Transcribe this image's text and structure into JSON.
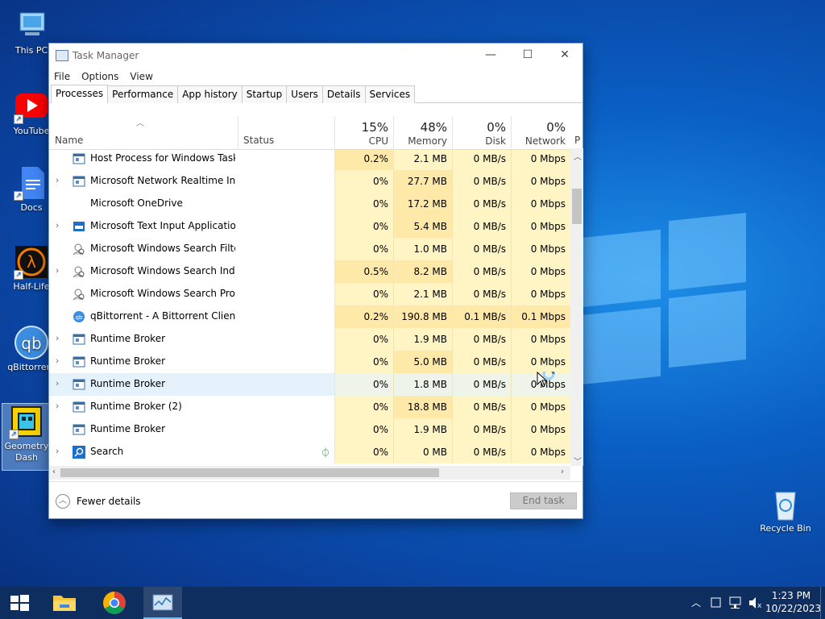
{
  "desktop": {
    "icons": [
      {
        "label": "This PC"
      },
      {
        "label": "YouTube"
      },
      {
        "label": "Docs"
      },
      {
        "label": "Half-Life"
      },
      {
        "label": "qBittorrent"
      },
      {
        "label": "Geometry Dash"
      },
      {
        "label": "Recycle Bin"
      }
    ]
  },
  "window": {
    "title": "Task Manager",
    "controls": {
      "minimize": "—",
      "maximize": "☐",
      "close": "✕"
    },
    "menu": [
      "File",
      "Options",
      "View"
    ],
    "tabs": [
      "Processes",
      "Performance",
      "App history",
      "Startup",
      "Users",
      "Details",
      "Services"
    ],
    "active_tab": "Processes"
  },
  "columns": {
    "name": "Name",
    "status": "Status",
    "cpu": {
      "pct": "15%",
      "label": "CPU"
    },
    "memory": {
      "pct": "48%",
      "label": "Memory"
    },
    "disk": {
      "pct": "0%",
      "label": "Disk"
    },
    "network": {
      "pct": "0%",
      "label": "Network"
    },
    "extra": "P"
  },
  "processes": [
    {
      "name": "Host Process for Windows Tasks",
      "expand": false,
      "cpu": "0.2%",
      "mem": "2.1 MB",
      "disk": "0 MB/s",
      "net": "0 Mbps",
      "icon": "service-icon"
    },
    {
      "name": "Microsoft Network Realtime Ins...",
      "expand": true,
      "cpu": "0%",
      "mem": "27.7 MB",
      "disk": "0 MB/s",
      "net": "0 Mbps",
      "icon": "service-icon"
    },
    {
      "name": "Microsoft OneDrive",
      "expand": false,
      "cpu": "0%",
      "mem": "17.2 MB",
      "disk": "0 MB/s",
      "net": "0 Mbps",
      "icon": "none"
    },
    {
      "name": "Microsoft Text Input Application",
      "expand": true,
      "cpu": "0%",
      "mem": "5.4 MB",
      "disk": "0 MB/s",
      "net": "0 Mbps",
      "icon": "app-blue-icon"
    },
    {
      "name": "Microsoft Windows Search Filte...",
      "expand": false,
      "cpu": "0%",
      "mem": "1.0 MB",
      "disk": "0 MB/s",
      "net": "0 Mbps",
      "icon": "search-person-icon"
    },
    {
      "name": "Microsoft Windows Search Inde...",
      "expand": true,
      "cpu": "0.5%",
      "mem": "8.2 MB",
      "disk": "0 MB/s",
      "net": "0 Mbps",
      "icon": "search-person-icon"
    },
    {
      "name": "Microsoft Windows Search Prot...",
      "expand": false,
      "cpu": "0%",
      "mem": "2.1 MB",
      "disk": "0 MB/s",
      "net": "0 Mbps",
      "icon": "search-person-icon"
    },
    {
      "name": "qBittorrent - A Bittorrent Client",
      "expand": false,
      "cpu": "0.2%",
      "mem": "190.8 MB",
      "disk": "0.1 MB/s",
      "net": "0.1 Mbps",
      "icon": "qbittorrent-icon"
    },
    {
      "name": "Runtime Broker",
      "expand": true,
      "cpu": "0%",
      "mem": "1.9 MB",
      "disk": "0 MB/s",
      "net": "0 Mbps",
      "icon": "service-icon"
    },
    {
      "name": "Runtime Broker",
      "expand": true,
      "cpu": "0%",
      "mem": "5.0 MB",
      "disk": "0 MB/s",
      "net": "0 Mbps",
      "icon": "service-icon"
    },
    {
      "name": "Runtime Broker",
      "expand": true,
      "cpu": "0%",
      "mem": "1.8 MB",
      "disk": "0 MB/s",
      "net": "0 Mbps",
      "icon": "service-icon"
    },
    {
      "name": "Runtime Broker (2)",
      "expand": true,
      "cpu": "0%",
      "mem": "18.8 MB",
      "disk": "0 MB/s",
      "net": "0 Mbps",
      "icon": "service-icon"
    },
    {
      "name": "Runtime Broker",
      "expand": false,
      "cpu": "0%",
      "mem": "1.9 MB",
      "disk": "0 MB/s",
      "net": "0 Mbps",
      "icon": "service-icon"
    },
    {
      "name": "Search",
      "expand": true,
      "cpu": "0%",
      "mem": "0 MB",
      "disk": "0 MB/s",
      "net": "0 Mbps",
      "icon": "search-icon",
      "status_icon": "leaf-icon"
    }
  ],
  "footer": {
    "fewer_details": "Fewer details",
    "end_task": "End task"
  },
  "taskbar": {
    "time": "1:23 PM",
    "date": "10/22/2023"
  }
}
